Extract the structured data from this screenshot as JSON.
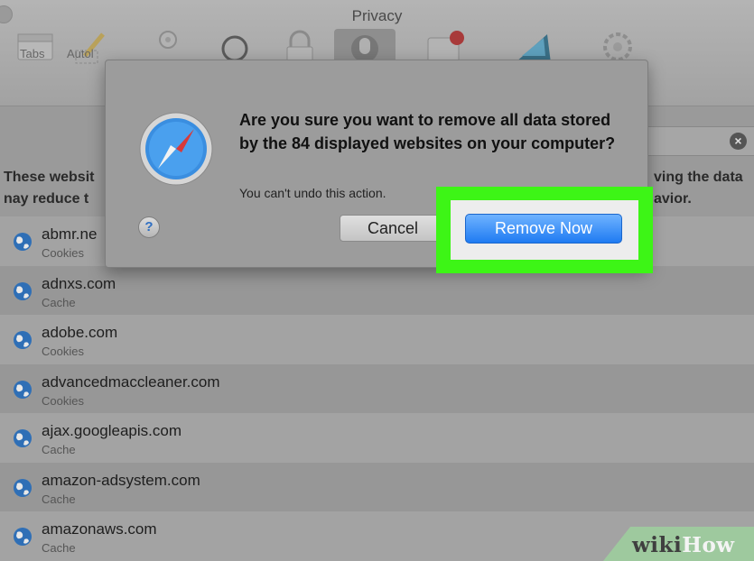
{
  "window": {
    "title": "Privacy"
  },
  "toolbar": {
    "items": [
      {
        "label": "Tabs"
      },
      {
        "label": "Autol"
      }
    ]
  },
  "description": {
    "line1_left": "These websit",
    "line2_left": "nay reduce t",
    "line1_right": "ving the data",
    "line2_right": "avior."
  },
  "dialog": {
    "title": "Are you sure you want to remove all data stored by the 84 displayed websites on your computer?",
    "subtitle": "You can't undo this action.",
    "cancel_label": "Cancel",
    "remove_label": "Remove Now",
    "help_label": "?"
  },
  "sites": [
    {
      "name": "abmr.ne",
      "type": "Cookies"
    },
    {
      "name": "adnxs.com",
      "type": "Cache"
    },
    {
      "name": "adobe.com",
      "type": "Cookies"
    },
    {
      "name": "advancedmaccleaner.com",
      "type": "Cookies"
    },
    {
      "name": "ajax.googleapis.com",
      "type": "Cache"
    },
    {
      "name": "amazon-adsystem.com",
      "type": "Cache"
    },
    {
      "name": "amazonaws.com",
      "type": "Cache"
    }
  ],
  "watermark": {
    "wiki": "wiki",
    "how": "How"
  },
  "colors": {
    "highlight": "#3df516",
    "primary_button": "#1f7bf2"
  }
}
